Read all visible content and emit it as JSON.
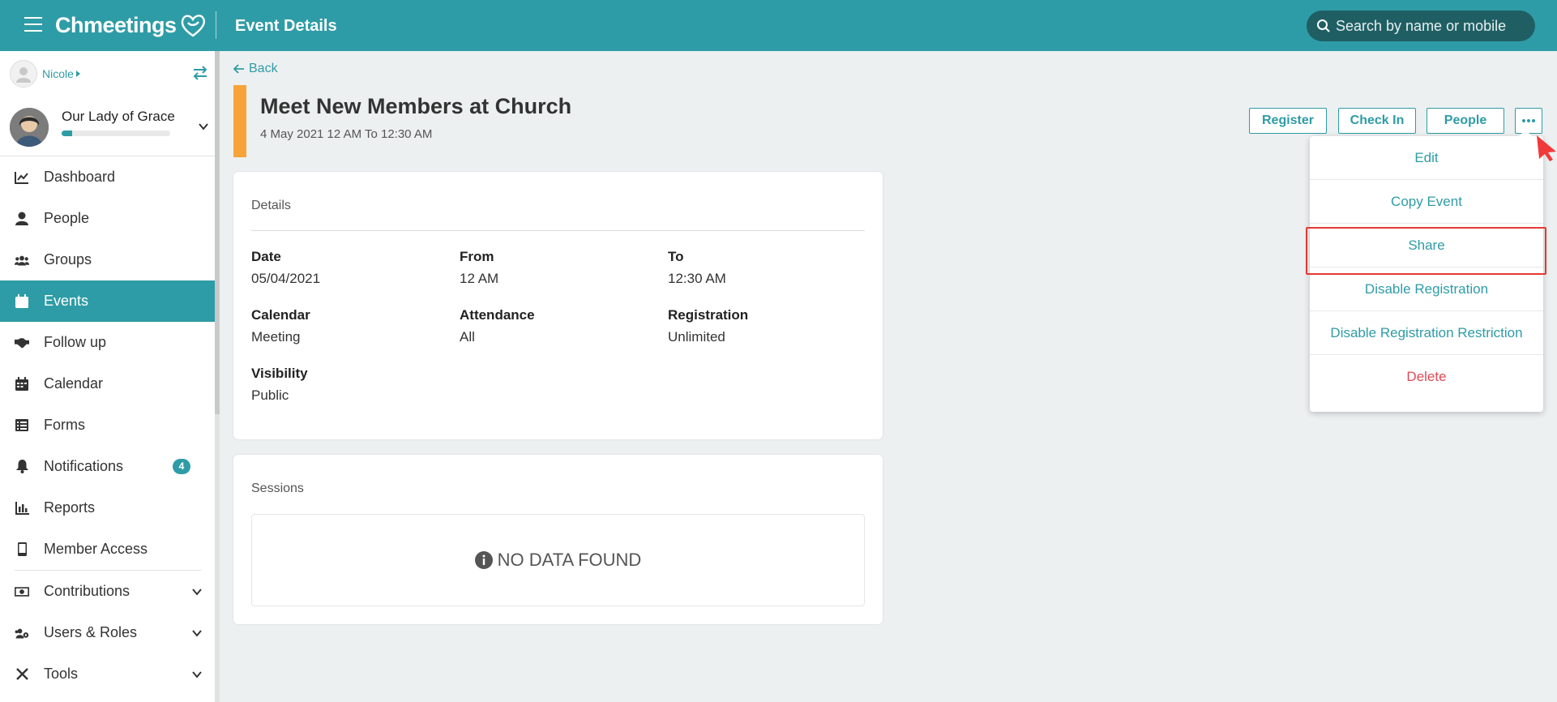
{
  "app": {
    "brand": "Chmeetings",
    "page_title": "Event Details",
    "search_placeholder": "Search by name or mobile"
  },
  "sidebar": {
    "user_name": "Nicole",
    "org_name": "Our Lady of Grace",
    "org_progress": 0.1,
    "items": [
      {
        "label": "Dashboard",
        "icon": "chart-icon"
      },
      {
        "label": "People",
        "icon": "person-icon"
      },
      {
        "label": "Groups",
        "icon": "group-icon"
      },
      {
        "label": "Events",
        "icon": "calendar-event-icon",
        "active": true
      },
      {
        "label": "Follow up",
        "icon": "handshake-icon"
      },
      {
        "label": "Calendar",
        "icon": "calendar-icon"
      },
      {
        "label": "Forms",
        "icon": "list-icon"
      },
      {
        "label": "Notifications",
        "icon": "bell-icon",
        "badge": "4"
      },
      {
        "label": "Reports",
        "icon": "bar-chart-icon"
      },
      {
        "label": "Member Access",
        "icon": "mobile-icon"
      },
      {
        "label": "Contributions",
        "icon": "money-icon",
        "expandable": true
      },
      {
        "label": "Users & Roles",
        "icon": "users-cog-icon",
        "expandable": true
      },
      {
        "label": "Tools",
        "icon": "tools-icon",
        "expandable": true
      }
    ]
  },
  "event": {
    "back_label": "Back",
    "title": "Meet New Members at Church",
    "dates": "4 May 2021 12 AM To 12:30 AM"
  },
  "actions": {
    "register": "Register",
    "check_in": "Check In",
    "people": "People"
  },
  "details": {
    "heading": "Details",
    "fields": {
      "date": {
        "label": "Date",
        "value": "05/04/2021"
      },
      "from": {
        "label": "From",
        "value": "12 AM"
      },
      "to": {
        "label": "To",
        "value": "12:30 AM"
      },
      "calendar": {
        "label": "Calendar",
        "value": "Meeting"
      },
      "attendance": {
        "label": "Attendance",
        "value": "All"
      },
      "registration": {
        "label": "Registration",
        "value": "Unlimited"
      },
      "visibility": {
        "label": "Visibility",
        "value": "Public"
      }
    }
  },
  "sessions": {
    "heading": "Sessions",
    "empty_text": "NO DATA FOUND"
  },
  "menu": {
    "items": [
      "Edit",
      "Copy Event",
      "Share",
      "Disable Registration",
      "Disable Registration Restriction",
      "Delete"
    ]
  },
  "colors": {
    "primary": "#2e9ca6",
    "accent": "#f7a33a",
    "danger": "#e04a55",
    "highlight": "#e53935"
  }
}
